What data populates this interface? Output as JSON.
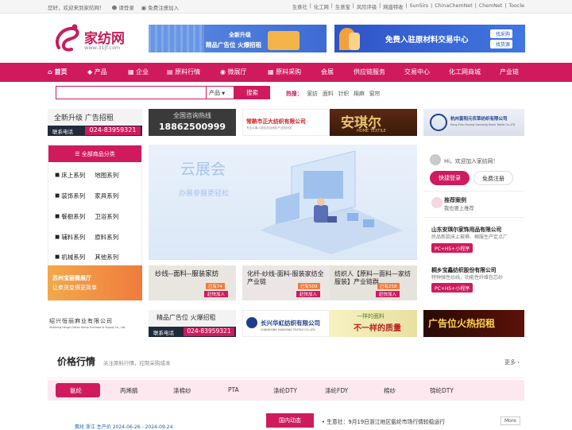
{
  "topbar": {
    "welcome": "您好，欢迎来到家纺网！",
    "login": "请登录",
    "register": "免费注册加入",
    "links": [
      "生意社",
      "|",
      "化工网",
      "|",
      "生意宝",
      "|",
      "风险评级",
      "|",
      "网盛特收",
      "|",
      "SunSirs",
      "|",
      "ChinaChemNet",
      "|",
      "ChemNet",
      "|",
      "Toocle"
    ]
  },
  "logo": {
    "name": "家纺网",
    "url": "www.31jf.com"
  },
  "ad1": {
    "line1": "全新升级",
    "line2": "精品广告位 火爆招租"
  },
  "ad2": {
    "text": "免费入驻原材料交易中心",
    "tag1": "· 找采购",
    "tag2": "· 找货源"
  },
  "nav": [
    "首页",
    "产品",
    "企业",
    "原料行情",
    "微展厅",
    "原料采购",
    "会展",
    "供应链服务",
    "交易中心",
    "化工网商城",
    "产业链"
  ],
  "search": {
    "placeholder": "",
    "select": "产品",
    "button": "搜索"
  },
  "hot": {
    "label": "热搜：",
    "items": [
      "家纺",
      "面料",
      "针织",
      "棉麻",
      "窗帘"
    ]
  },
  "banners": {
    "b1": {
      "line1": "全新升级  广告招租",
      "line2": "联系电话",
      "phone": "024-83959321"
    },
    "b2": {
      "line1": "全国咨询热线",
      "phone": "18862500999"
    },
    "b3": {
      "name": "常熟市正大纺织有限公司",
      "sub": "专业从事人造毛皮及家纺产品的研发"
    },
    "b4": {
      "name": "安琪尔",
      "sub": "HOME TEXTILE"
    },
    "b5": {
      "name": "杭州富阳元农草纺织有限公司",
      "sub": "Hang Zhou Fuyang Yuannong Home Textile Co.,LTD"
    }
  },
  "category": {
    "header": "全部商品分类",
    "rows": [
      [
        "床上系列",
        "地图系列"
      ],
      [
        "装饰系列",
        "家具系列"
      ],
      [
        "餐橱系列",
        "卫浴系列"
      ],
      [
        "辅料系列",
        "原料系列"
      ],
      [
        "机械系列",
        "其他系列"
      ]
    ]
  },
  "hero": {
    "title": "云展会",
    "subtitle": "办展参展更轻松"
  },
  "user": {
    "greeting": "Hi，欢迎加入家纺网！",
    "login": "快捷登录",
    "register": "免费注册"
  },
  "recommend": {
    "title": "推荐案例",
    "sub": "我也要上推荐",
    "items": [
      {
        "name": "山东安琪尔家饰用品有限公司",
        "desc": "民品新款床上被褥、棉服生产定点厂",
        "tag": "PC+H5+小程序"
      },
      {
        "name": "桐乡宝鑫纺织股份有限公司",
        "desc": "特种弹性纱线，功能性纤维包芯纱",
        "tag": "PC+H5+小程序"
      }
    ]
  },
  "midads": {
    "a1": {
      "line1": "苏州宝丽微展厅",
      "line2": "让卖货变得更简单"
    },
    "a2": {
      "title": "纱线--面料--服装家纺",
      "count": "已有74",
      "btn": "赶快加入"
    },
    "a3": {
      "title": "化纤-纱线-面料-服装家纺全产业链",
      "count": "已有509",
      "btn": "赶快加入"
    },
    "a4": {
      "title": "纺织人【原料—面料—家纺服装】产业链群",
      "count": "已有258",
      "btn": "赶快加入"
    }
  },
  "row3": {
    "c1": {
      "name": "绍兴恒丽麻业有限公司",
      "sub": "Shaoxing Hengli Cotton Hemp Purchase & Supply Co., Ltd."
    },
    "c2": {
      "line1": "精品广告位 火爆招租",
      "line2": "联系电话",
      "phone": "024-83959321"
    },
    "c3": {
      "name": "长兴华虹纺织有限公司",
      "sub": "CHANGXING HUAHONG TEXTILE CO.,LTD"
    },
    "c4": {
      "line1": "一样的面料",
      "line2": "不一样的质量"
    },
    "c5": {
      "text": "广告位火热招租"
    }
  },
  "price": {
    "title": "价格行情",
    "sub": "关注原料行情，控制采购成本",
    "more": "更多",
    "tabs": [
      "氨纶",
      "丙烯腈",
      "涤棉纱",
      "PTA",
      "涤纶DTY",
      "涤纶FDY",
      "棉纱",
      "锦纶DTY"
    ]
  },
  "bottom": {
    "left": "氨纶 浙江 生产价 2024-06-26 - 2024-09-24",
    "badge": "国内动态",
    "news": "生意社：9月19日浙江地区氨纶市场行情较稳运行",
    "more": "More"
  },
  "colors": {
    "accent": "#cf1b5e"
  }
}
